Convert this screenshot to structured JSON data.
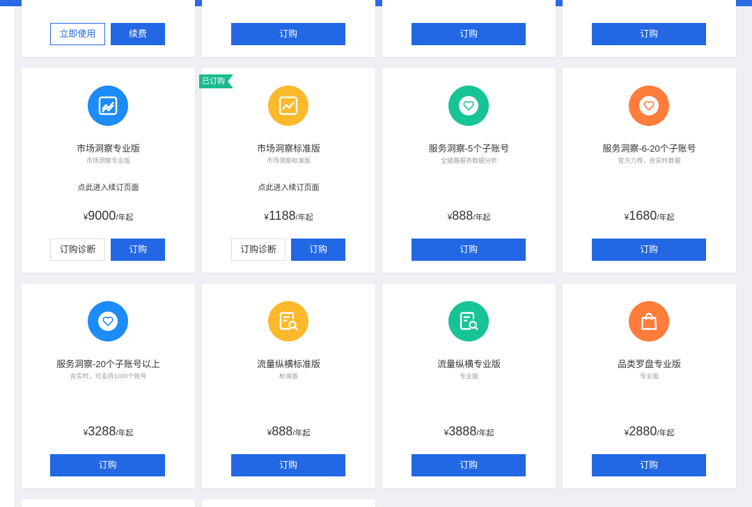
{
  "row0": {
    "card1": {
      "use_now": "立即使用",
      "renew": "续费"
    },
    "card2": {
      "buy": "订购"
    },
    "card3": {
      "buy": "订购"
    },
    "card4": {
      "buy": "订购"
    }
  },
  "row1": [
    {
      "title": "市场洞察专业版",
      "subtitle": "市场洞察专业版",
      "renew_link": "点此进入续订页面",
      "yen": "¥",
      "price": "9000",
      "unit": "/年起",
      "diag": "订购诊断",
      "buy": "订购",
      "icon": "trend-chart-icon",
      "color": "#1b8cf8"
    },
    {
      "title": "市场洞察标准版",
      "subtitle": "市场洞察标准版",
      "renew_link": "点此进入续订页面",
      "yen": "¥",
      "price": "1188",
      "unit": "/年起",
      "diag": "订购诊断",
      "buy": "订购",
      "badge": "已订购",
      "icon": "trend-chart-icon",
      "color": "#fdb92c"
    },
    {
      "title": "服务洞察-5个子账号",
      "subtitle": "全链路服务数据分析",
      "yen": "¥",
      "price": "888",
      "unit": "/年起",
      "buy": "订购",
      "icon": "heart-icon",
      "color": "#16c495"
    },
    {
      "title": "服务洞察-6-20个子账号",
      "subtitle": "官方力荐，含实时数据",
      "yen": "¥",
      "price": "1680",
      "unit": "/年起",
      "buy": "订购",
      "icon": "heart-icon",
      "color": "#fe7d3a"
    }
  ],
  "row2": [
    {
      "title": "服务洞察-20个子账号以上",
      "subtitle": "含实时，可支持1000个账号",
      "yen": "¥",
      "price": "3288",
      "unit": "/年起",
      "buy": "订购",
      "icon": "heart-icon",
      "color": "#1b8cf8"
    },
    {
      "title": "流量纵横标准版",
      "subtitle": "标准版",
      "yen": "¥",
      "price": "888",
      "unit": "/年起",
      "buy": "订购",
      "icon": "document-search-icon",
      "color": "#fdb92c"
    },
    {
      "title": "流量纵横专业版",
      "subtitle": "专业版",
      "yen": "¥",
      "price": "3888",
      "unit": "/年起",
      "buy": "订购",
      "icon": "document-search-icon",
      "color": "#16c495"
    },
    {
      "title": "品类罗盘专业版",
      "subtitle": "专业版",
      "yen": "¥",
      "price": "2880",
      "unit": "/年起",
      "buy": "订购",
      "icon": "shopping-bag-icon",
      "color": "#fe7d3a"
    }
  ]
}
